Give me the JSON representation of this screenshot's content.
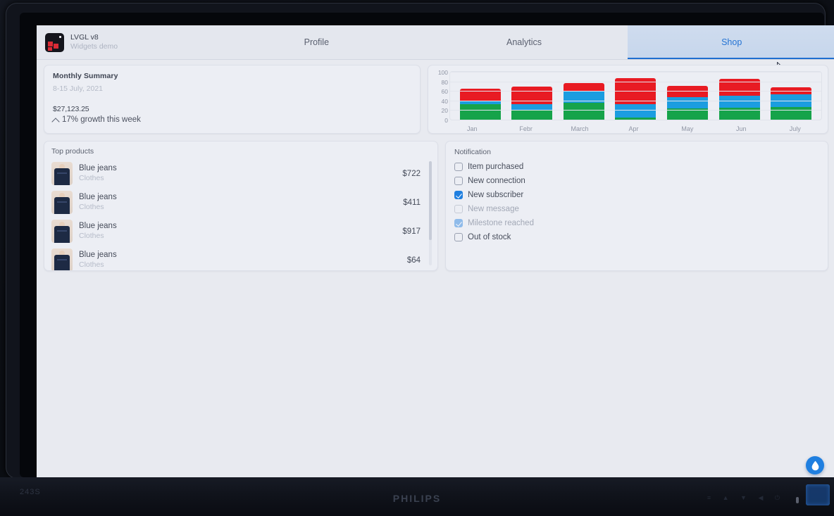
{
  "monitor": {
    "brand": "PHILIPS",
    "model": "243S",
    "key_glyphs": "≡ ▲ ▼ ◀ ⏻"
  },
  "header": {
    "app_title": "LVGL v8",
    "app_subtitle": "Widgets demo",
    "tabs": [
      {
        "label": "Profile",
        "active": false
      },
      {
        "label": "Analytics",
        "active": false
      },
      {
        "label": "Shop",
        "active": true
      }
    ]
  },
  "summary": {
    "title": "Monthly Summary",
    "date_range": "8-15 July, 2021",
    "amount": "$27,123.25",
    "growth": "17% growth this week",
    "growth_icon": "arrow-up-icon"
  },
  "chart_data": {
    "type": "bar",
    "stacked": true,
    "title": "",
    "xlabel": "",
    "ylabel": "",
    "ylim": [
      0,
      100
    ],
    "yticks": [
      100,
      80,
      60,
      40,
      20,
      0
    ],
    "grid": true,
    "legend": "none",
    "categories": [
      "Jan",
      "Febr",
      "March",
      "Apr",
      "May",
      "Jun",
      "July"
    ],
    "series": [
      {
        "name": "green",
        "color": "#16a34a",
        "values": [
          33,
          20,
          36,
          5,
          24,
          25,
          27
        ]
      },
      {
        "name": "blue",
        "color": "#1b9de0",
        "values": [
          7,
          13,
          23,
          27,
          23,
          25,
          26
        ]
      },
      {
        "name": "red",
        "color": "#e81b23",
        "values": [
          25,
          36,
          17,
          55,
          23,
          35,
          15
        ]
      }
    ],
    "totals": [
      65,
      69,
      76,
      87,
      70,
      85,
      68
    ]
  },
  "products": {
    "title": "Top products",
    "items": [
      {
        "name": "Blue jeans",
        "category": "Clothes",
        "price": "$722"
      },
      {
        "name": "Blue jeans",
        "category": "Clothes",
        "price": "$411"
      },
      {
        "name": "Blue jeans",
        "category": "Clothes",
        "price": "$917"
      },
      {
        "name": "Blue jeans",
        "category": "Clothes",
        "price": "$64"
      }
    ]
  },
  "notification": {
    "title": "Notification",
    "items": [
      {
        "label": "Item purchased",
        "checked": false,
        "disabled": false
      },
      {
        "label": "New connection",
        "checked": false,
        "disabled": false
      },
      {
        "label": "New subscriber",
        "checked": true,
        "disabled": false
      },
      {
        "label": "New message",
        "checked": false,
        "disabled": true
      },
      {
        "label": "Milestone reached",
        "checked": true,
        "disabled": true
      },
      {
        "label": "Out of stock",
        "checked": false,
        "disabled": false
      }
    ]
  },
  "fab": {
    "icon": "water-drop-icon",
    "color": "#1f7fe0"
  },
  "colors": {
    "accent": "#1f7fe0",
    "screen_bg": "#e8eaf0",
    "card_bg": "#eceef4",
    "bar_green": "#16a34a",
    "bar_blue": "#1b9de0",
    "bar_red": "#e81b23"
  }
}
